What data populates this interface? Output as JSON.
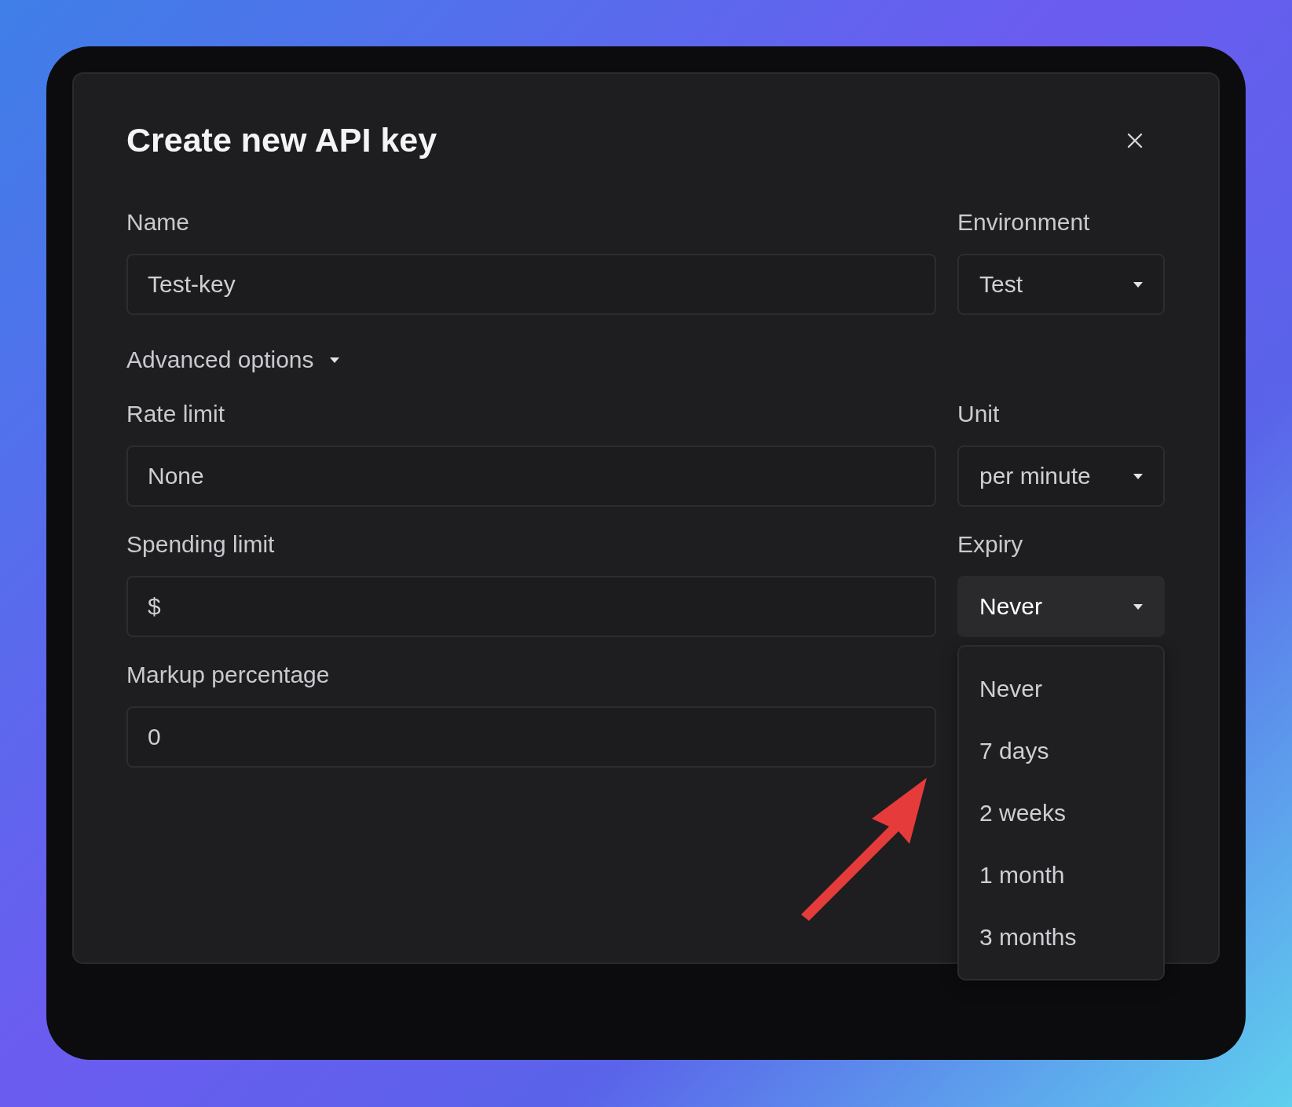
{
  "dialog": {
    "title": "Create new API key"
  },
  "name_field": {
    "label": "Name",
    "value": "Test-key"
  },
  "environment": {
    "label": "Environment",
    "value": "Test",
    "open": false
  },
  "advanced_options": {
    "label": "Advanced options",
    "expanded": true
  },
  "rate_limit": {
    "label": "Rate limit",
    "placeholder": "None"
  },
  "unit": {
    "label": "Unit",
    "value": "per minute",
    "open": false
  },
  "spending_limit": {
    "label": "Spending limit",
    "placeholder": "$"
  },
  "expiry": {
    "label": "Expiry",
    "value": "Never",
    "open": true,
    "options": [
      {
        "label": "Never"
      },
      {
        "label": "7 days"
      },
      {
        "label": "2 weeks"
      },
      {
        "label": "1 month"
      },
      {
        "label": "3 months"
      }
    ]
  },
  "markup_percentage": {
    "label": "Markup percentage",
    "value": "0"
  }
}
